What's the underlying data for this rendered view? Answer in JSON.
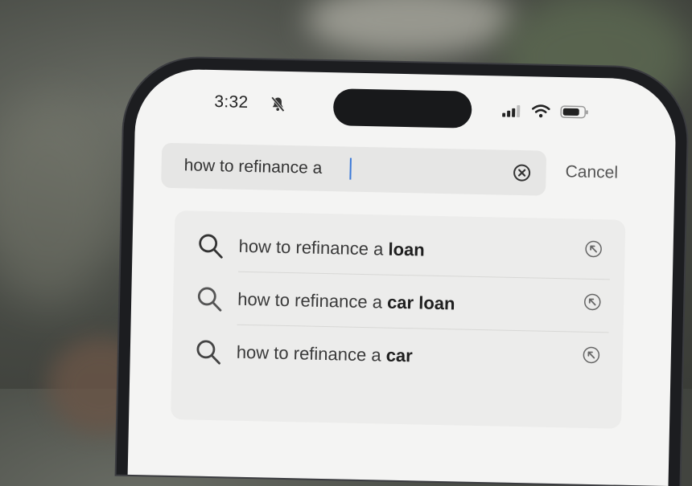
{
  "status_bar": {
    "time": "3:32",
    "icons": [
      "bell-slash-icon",
      "cellular-signal-icon",
      "wifi-icon",
      "battery-icon"
    ]
  },
  "search": {
    "query": "how to refinance a",
    "clear_icon": "clear-circle-icon",
    "cancel_label": "Cancel"
  },
  "suggestions": [
    {
      "prefix": "how to refinance a ",
      "completion": "loan",
      "icon": "search-icon",
      "action_icon": "fill-query-arrow-icon"
    },
    {
      "prefix": "how to refinance a ",
      "completion": "car loan",
      "icon": "search-icon",
      "action_icon": "fill-query-arrow-icon"
    },
    {
      "prefix": "how to refinance a ",
      "completion": "car",
      "icon": "search-icon",
      "action_icon": "fill-query-arrow-icon"
    }
  ],
  "colors": {
    "caret": "#3b79d8",
    "screen_bg": "#f4f4f3"
  }
}
